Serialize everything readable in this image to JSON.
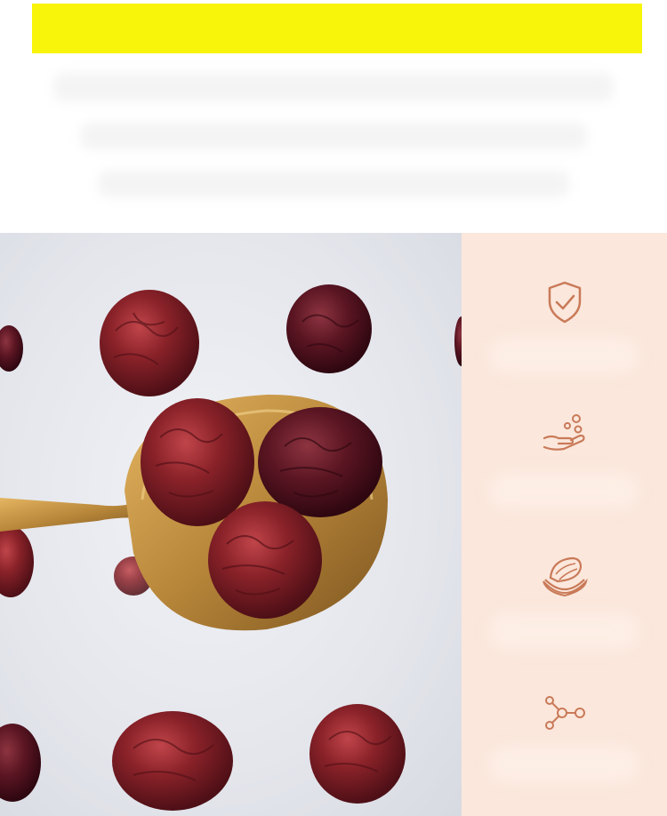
{
  "banner": {
    "color": "#f8f50a"
  },
  "features": [
    {
      "icon": "shield-check-icon"
    },
    {
      "icon": "hand-bubbles-icon"
    },
    {
      "icon": "nut-icon"
    },
    {
      "icon": "molecule-icon"
    }
  ],
  "colors": {
    "panel": "#fbe7dc",
    "icon_stroke": "#c97a58",
    "fruit": "#7a1f24",
    "spoon": "#c8963c"
  }
}
